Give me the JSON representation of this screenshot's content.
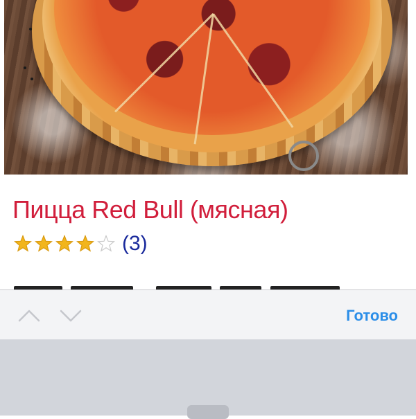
{
  "product": {
    "title": "Пицца Red Bull (мясная)",
    "rating": 4,
    "rating_max": 5,
    "review_count_label": "(3)"
  },
  "toolbar": {
    "prev_icon": "chevron-up-icon",
    "next_icon": "chevron-down-icon",
    "done_label": "Готово"
  },
  "colors": {
    "title": "#d11e3b",
    "review_count": "#1a2a9c",
    "star_filled": "#f2b51c",
    "star_empty": "#c9c9c9",
    "done": "#2b8ee8",
    "accessory_bg": "#f3f4f6",
    "keyboard_bg": "#d2d5db"
  }
}
